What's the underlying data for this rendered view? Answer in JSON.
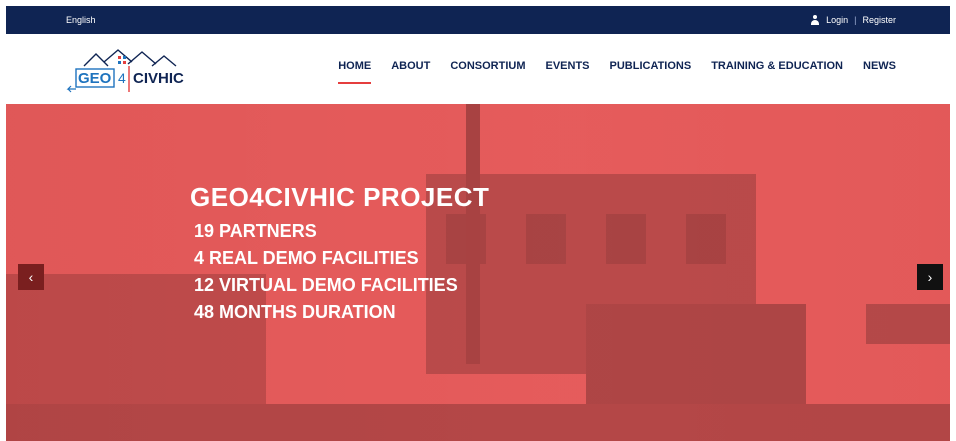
{
  "topbar": {
    "language": "English",
    "login": "Login",
    "separator": "|",
    "register": "Register"
  },
  "logo": {
    "text_left": "GEO",
    "text_num": "4",
    "text_right": "CIVHIC"
  },
  "nav": {
    "items": [
      "HOME",
      "ABOUT",
      "CONSORTIUM",
      "EVENTS",
      "PUBLICATIONS",
      "TRAINING & EDUCATION",
      "NEWS"
    ]
  },
  "hero": {
    "title": "GEO4CIVHIC PROJECT",
    "lines": [
      "19 PARTNERS",
      "4 REAL DEMO FACILITIES",
      "12 VIRTUAL DEMO FACILITIES",
      "48 MONTHS DURATION"
    ],
    "prev_icon": "‹",
    "next_icon": "›"
  },
  "colors": {
    "topbar_bg": "#0f2453",
    "nav_text": "#0f2453",
    "accent": "#e53e3e",
    "hero_overlay": "#e85a5a"
  }
}
